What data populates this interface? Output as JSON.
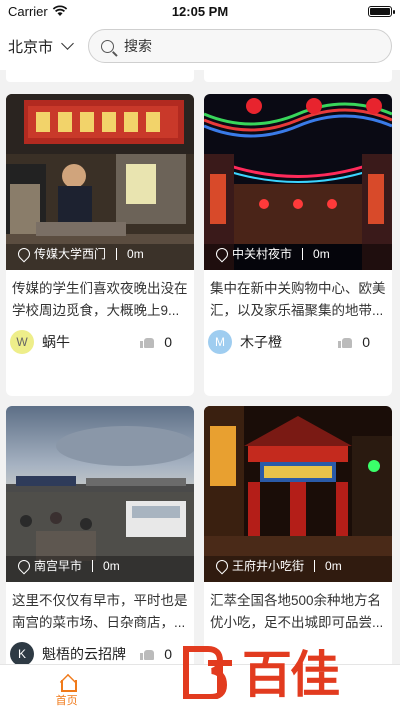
{
  "status_bar": {
    "carrier": "Carrier",
    "time": "12:05 PM"
  },
  "header": {
    "city": "北京市",
    "search_placeholder": "搜索"
  },
  "cards": [
    {
      "location": "传媒大学西门",
      "distance": "0m",
      "description": "传媒的学生们喜欢夜晚出没在学校周边觅食，大概晚上9...",
      "author": "蜗牛",
      "avatar_letter": "W",
      "avatar_color": "#e8e86a",
      "likes": "0"
    },
    {
      "location": "中关村夜市",
      "distance": "0m",
      "description": "集中在新中关购物中心、欧美汇，以及家乐福聚集的地带...",
      "author": "木子橙",
      "avatar_letter": "M",
      "avatar_color": "#9fcdf0",
      "likes": "0"
    },
    {
      "location": "南宫早市",
      "distance": "0m",
      "description": "这里不仅仅有早市，平时也是南宫的菜市场、日杂商店，...",
      "author": "魁梧的云招牌",
      "avatar_letter": "K",
      "avatar_color": "#2e3a44",
      "likes": "0"
    },
    {
      "location": "王府井小吃街",
      "distance": "0m",
      "description": "汇萃全国各地500余种地方名优小吃，足不出城即可品尝...",
      "author": "",
      "avatar_letter": "",
      "avatar_color": "#cccccc",
      "likes": ""
    }
  ],
  "tabbar": {
    "tabs": [
      {
        "label": "首页",
        "icon": "home-icon",
        "active": true
      },
      {
        "label": "",
        "icon": "",
        "active": false
      },
      {
        "label": "",
        "icon": "",
        "active": false
      }
    ]
  },
  "watermark": {
    "text": "百佳"
  },
  "colors": {
    "accent": "#f07a1a",
    "watermark": "#e23b1f"
  }
}
